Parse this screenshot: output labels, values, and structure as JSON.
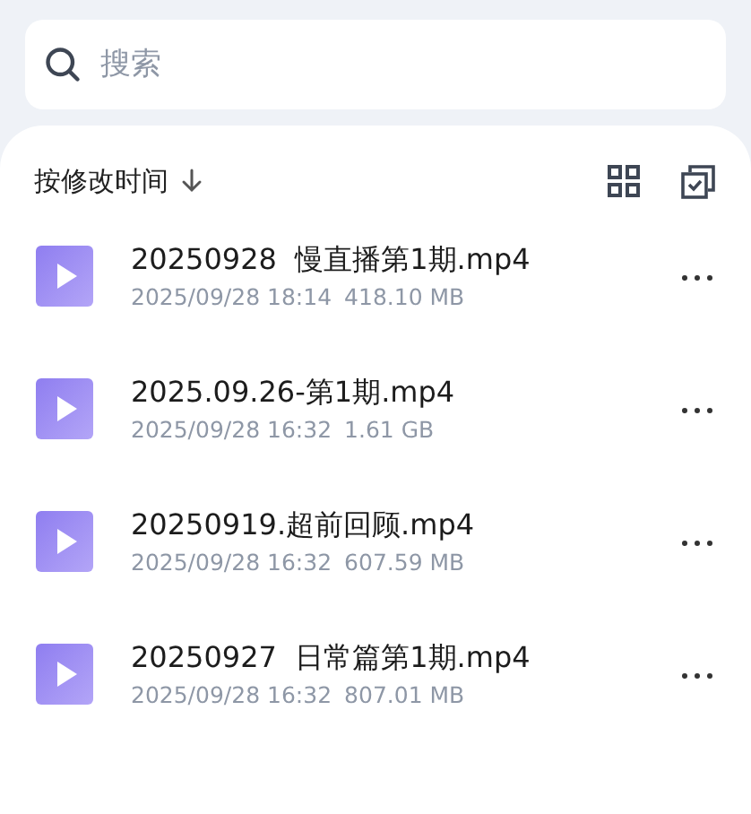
{
  "search": {
    "placeholder": "搜索"
  },
  "sort": {
    "label": "按修改时间"
  },
  "files": [
    {
      "name": "20250928  慢直播第1期.mp4",
      "date": "2025/09/28 18:14",
      "size": "418.10 MB"
    },
    {
      "name": "2025.09.26-第1期.mp4",
      "date": "2025/09/28 16:32",
      "size": "1.61 GB"
    },
    {
      "name": "20250919.超前回顾.mp4",
      "date": "2025/09/28 16:32",
      "size": "607.59 MB"
    },
    {
      "name": "20250927  日常篇第1期.mp4",
      "date": "2025/09/28 16:32",
      "size": "807.01 MB"
    }
  ]
}
